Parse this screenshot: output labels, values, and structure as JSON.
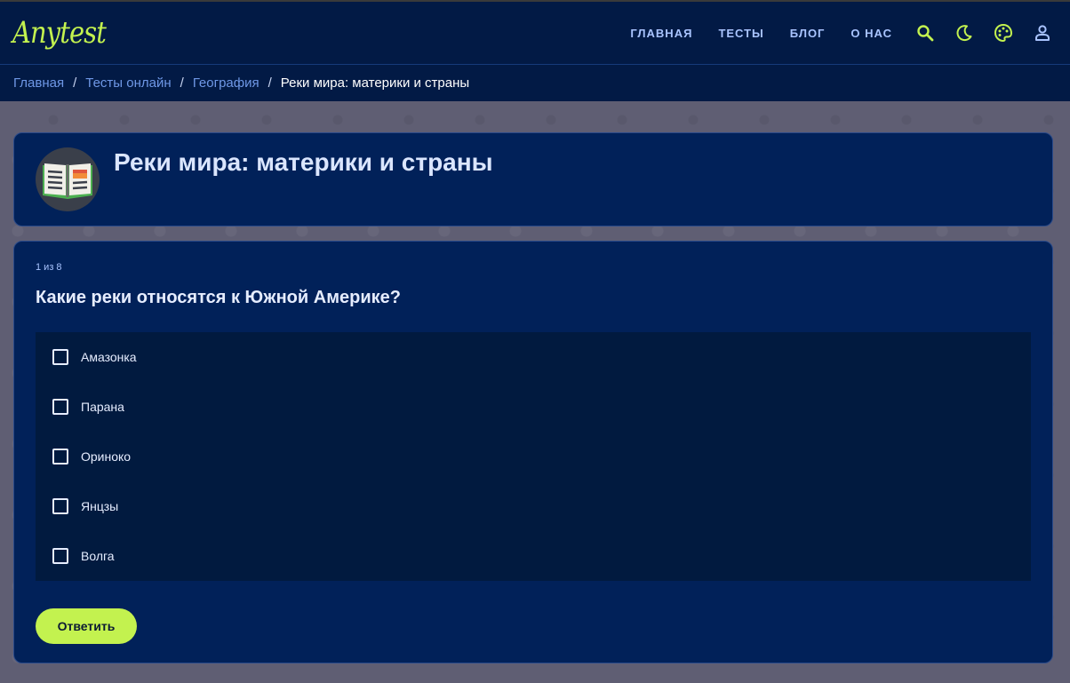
{
  "brand": {
    "logo_text": "Anytest",
    "accent": "#c3f24f",
    "nav_bg": "#021a45",
    "card_bg": "#012159"
  },
  "nav": {
    "items": [
      {
        "label": "ГЛАВНАЯ"
      },
      {
        "label": "ТЕСТЫ"
      },
      {
        "label": "БЛОГ"
      },
      {
        "label": "О НАС"
      }
    ],
    "icons": [
      "search-icon",
      "moon-icon",
      "palette-icon",
      "user-icon"
    ]
  },
  "breadcrumb": {
    "links": [
      {
        "label": "Главная"
      },
      {
        "label": "Тесты онлайн"
      },
      {
        "label": "География"
      }
    ],
    "separator": "/",
    "current": "Реки мира: материки и страны"
  },
  "test": {
    "title": "Реки мира: материки и страны",
    "icon": "open-book-icon"
  },
  "quiz": {
    "progress": "1 из 8",
    "question": "Какие реки относятся к Южной Америке?",
    "options": [
      {
        "label": "Амазонка",
        "checked": false
      },
      {
        "label": "Парана",
        "checked": false
      },
      {
        "label": "Ориноко",
        "checked": false
      },
      {
        "label": "Янцзы",
        "checked": false
      },
      {
        "label": "Волга",
        "checked": false
      }
    ],
    "submit_label": "Ответить"
  }
}
